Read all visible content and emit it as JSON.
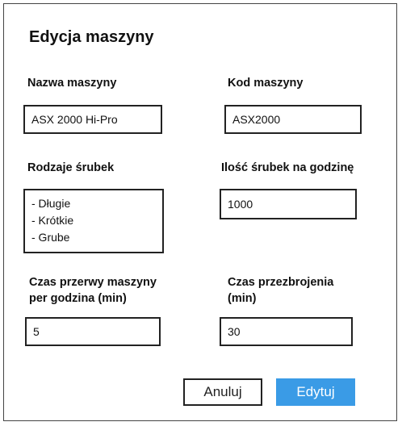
{
  "dialog": {
    "title": "Edycja maszyny"
  },
  "fields": {
    "machine_name": {
      "label": "Nazwa maszyny",
      "value": "ASX 2000 Hi-Pro"
    },
    "machine_code": {
      "label": "Kod maszyny",
      "value": "ASX2000"
    },
    "screw_types": {
      "label": "Rodzaje śrubek",
      "items": [
        "- Długie",
        "- Krótkie",
        "- Grube"
      ]
    },
    "screws_per_hour": {
      "label": "Ilość śrubek na godzinę",
      "value": "1000"
    },
    "break_time": {
      "label_line1": "Czas przerwy maszyny",
      "label_line2": "per godzina (min)",
      "value": "5"
    },
    "changeover_time": {
      "label_line1": "Czas przezbrojenia",
      "label_line2": "(min)",
      "value": "30"
    }
  },
  "buttons": {
    "cancel_label": "Anuluj",
    "edit_label": "Edytuj"
  },
  "colors": {
    "primary": "#3a9be6",
    "border": "#222222"
  }
}
